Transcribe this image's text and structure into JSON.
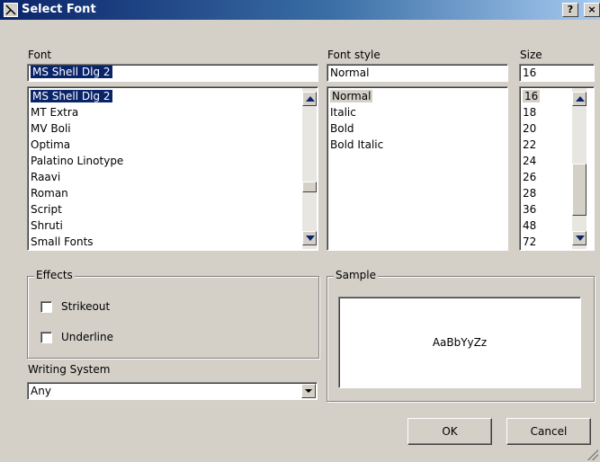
{
  "window": {
    "title": "Select Font",
    "help_label": "?",
    "close_label": "×"
  },
  "font": {
    "label": "Font",
    "value": "MS Shell Dlg 2",
    "items": [
      "MS Shell Dlg 2",
      "MT Extra",
      "MV Boli",
      "Optima",
      "Palatino Linotype",
      "Raavi",
      "Roman",
      "Script",
      "Shruti",
      "Small Fonts"
    ],
    "selected_index": 0
  },
  "font_style": {
    "label": "Font style",
    "value": "Normal",
    "items": [
      "Normal",
      "Italic",
      "Bold",
      "Bold Italic"
    ],
    "selected_index": 0
  },
  "size": {
    "label": "Size",
    "value": "16",
    "items": [
      "16",
      "18",
      "20",
      "22",
      "24",
      "26",
      "28",
      "36",
      "48",
      "72"
    ],
    "selected_index": 0
  },
  "effects": {
    "label": "Effects",
    "strikeout_label": "Strikeout",
    "strikeout_checked": false,
    "underline_label": "Underline",
    "underline_checked": false
  },
  "writing_system": {
    "label": "Writing System",
    "value": "Any"
  },
  "sample": {
    "label": "Sample",
    "text": "AaBbYyZz"
  },
  "buttons": {
    "ok": "OK",
    "cancel": "Cancel"
  }
}
